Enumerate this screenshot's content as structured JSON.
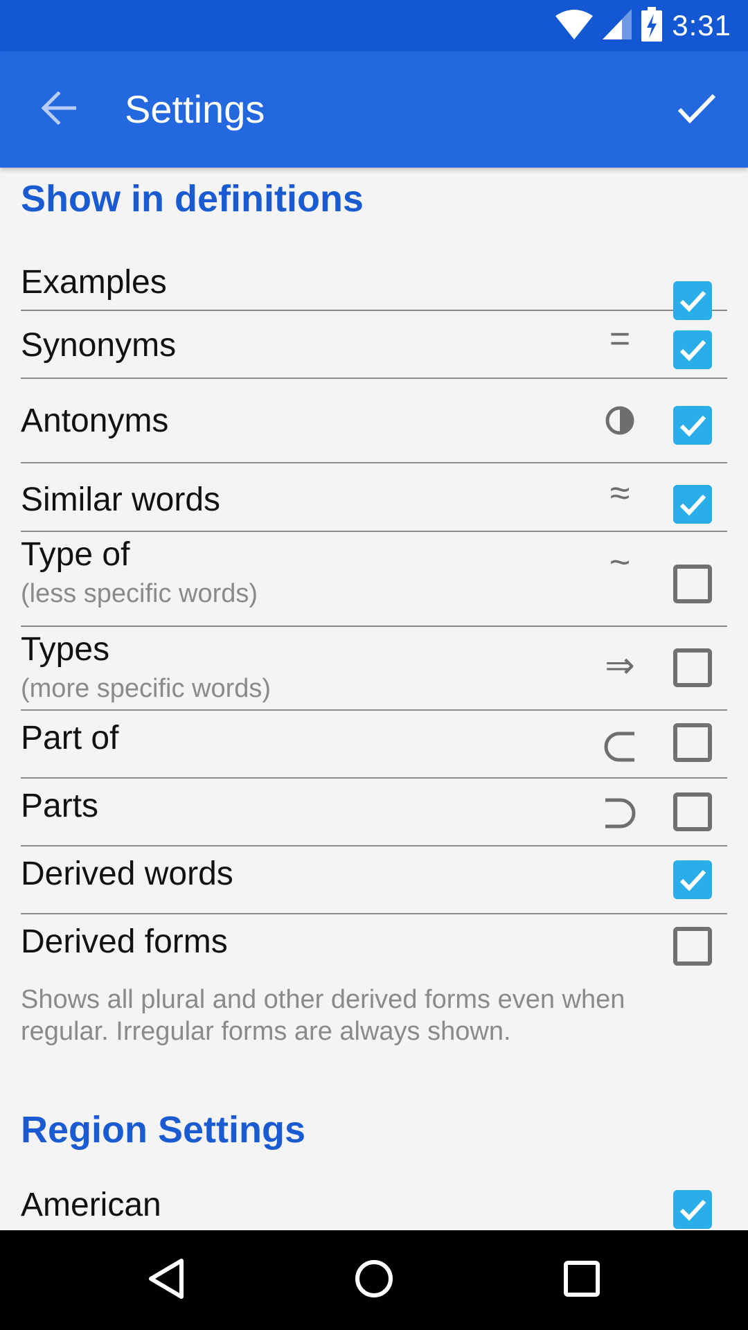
{
  "status_bar": {
    "time": "3:31",
    "icons": [
      "wifi-icon",
      "cell-signal-icon",
      "battery-charging-icon"
    ]
  },
  "app_bar": {
    "title": "Settings",
    "back_icon": "arrow-left-icon",
    "done_icon": "check-icon"
  },
  "sections": [
    {
      "title": "Show in definitions",
      "items": [
        {
          "label": "Examples",
          "sublabel": "",
          "symbol": "",
          "symbol_icon": "",
          "checked": true
        },
        {
          "label": "Synonyms",
          "sublabel": "",
          "symbol": "=",
          "symbol_icon": "equals-icon",
          "checked": true
        },
        {
          "label": "Antonyms",
          "sublabel": "",
          "symbol": "◑",
          "symbol_icon": "half-circle-icon",
          "checked": true
        },
        {
          "label": "Similar words",
          "sublabel": "",
          "symbol": "≈",
          "symbol_icon": "approx-icon",
          "checked": true
        },
        {
          "label": "Type of",
          "sublabel": "(less specific words)",
          "symbol": "~",
          "symbol_icon": "tilde-icon",
          "checked": false
        },
        {
          "label": "Types",
          "sublabel": "(more specific words)",
          "symbol": "⇒",
          "symbol_icon": "double-arrow-right-icon",
          "checked": false
        },
        {
          "label": "Part of",
          "sublabel": "",
          "symbol": "⊂",
          "symbol_icon": "subset-icon",
          "checked": false
        },
        {
          "label": "Parts",
          "sublabel": "",
          "symbol": "⊃",
          "symbol_icon": "superset-icon",
          "checked": false
        },
        {
          "label": "Derived words",
          "sublabel": "",
          "symbol": "",
          "symbol_icon": "",
          "checked": true
        },
        {
          "label": "Derived forms",
          "sublabel": "",
          "symbol": "",
          "symbol_icon": "",
          "checked": false
        }
      ],
      "helper": "Shows all plural and other derived forms even when regular. Irregular forms are always shown."
    },
    {
      "title": "Region Settings",
      "items": [
        {
          "label": "American",
          "sublabel": "",
          "symbol": "",
          "symbol_icon": "",
          "checked": true
        }
      ]
    }
  ],
  "nav_bar": {
    "back": "nav-back-icon",
    "home": "nav-home-icon",
    "recents": "nav-recents-icon"
  },
  "colors": {
    "status_bar": "#1358d2",
    "app_bar": "#2368de",
    "section_header": "#1a5bd2",
    "checkbox_checked": "#2aaeea",
    "checkbox_unchecked": "#717171",
    "background": "#f4f4f4"
  }
}
